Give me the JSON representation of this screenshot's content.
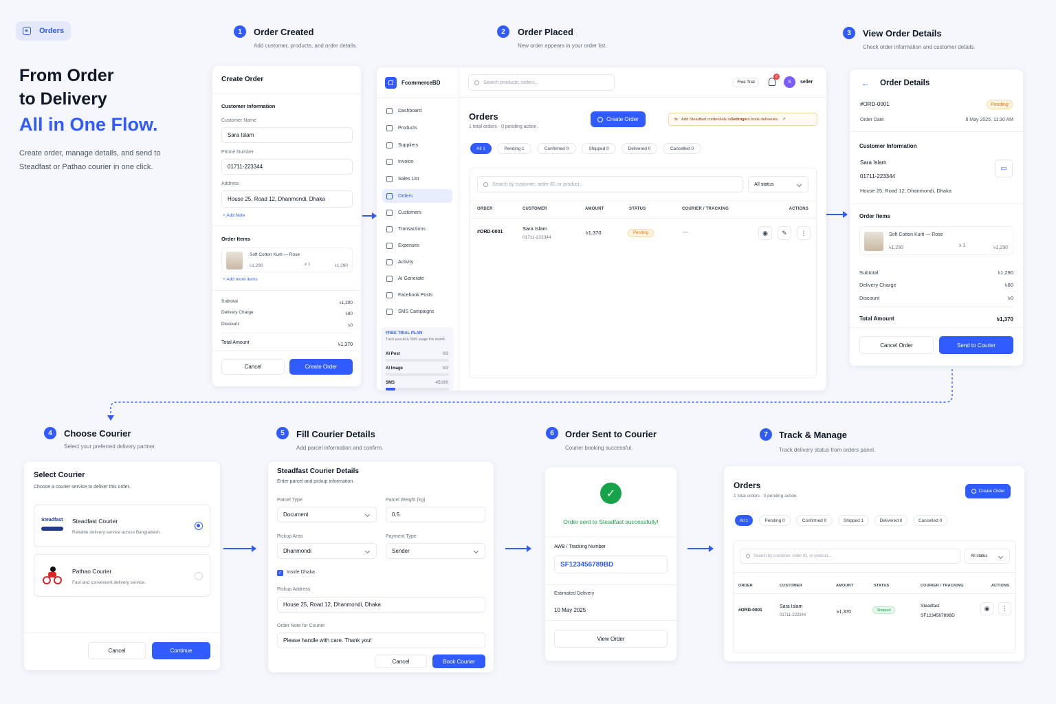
{
  "pill": {
    "label": "Orders"
  },
  "hero": {
    "line1": "From Order",
    "line2": "to Delivery",
    "line3": "All in One Flow.",
    "desc1": "Create order, manage details, and send to",
    "desc2": "Steadfast or Pathao courier in one click."
  },
  "steps": [
    {
      "num": "1",
      "title": "Order Created",
      "sub": "Add customer, products, and order details."
    },
    {
      "num": "2",
      "title": "Order Placed",
      "sub": "New order appears in your order list."
    },
    {
      "num": "3",
      "title": "View Order Details",
      "sub": "Check order information and customer details."
    },
    {
      "num": "4",
      "title": "Choose Courier",
      "sub": "Select your preferred delivery partner."
    },
    {
      "num": "5",
      "title": "Fill Courier Details",
      "sub": "Add parcel information and confirm."
    },
    {
      "num": "6",
      "title": "Order Sent to Courier",
      "sub": "Courier booking successful."
    },
    {
      "num": "7",
      "title": "Track & Manage",
      "sub": "Track delivery status from orders panel."
    }
  ],
  "create": {
    "title": "Create Order",
    "customer_section": "Customer Information",
    "name_label": "Customer Name",
    "name_value": "Sara Islam",
    "phone_label": "Phone Number",
    "phone_value": "01711-223344",
    "address_label": "Address",
    "address_value": "House 25, Road 12, Dhanmondi, Dhaka",
    "add_note": "Add Note",
    "items_section": "Order Items",
    "item_name": "Soft Cotton Kurti — Rose",
    "item_price": "৳1,290",
    "item_qty": "x 1",
    "item_total": "৳1,290",
    "add_more": "Add more items",
    "subtotal_label": "Subtotal",
    "subtotal": "৳1,290",
    "delivery_label": "Delivery Charge",
    "delivery": "৳80",
    "discount_label": "Discount",
    "discount": "৳0",
    "total_label": "Total Amount",
    "total": "৳1,370",
    "cancel": "Cancel",
    "submit": "Create Order"
  },
  "dashboard": {
    "brand": "FcommerceBD",
    "search_placeholder": "Search products, orders...",
    "free_trial": "Free Trial",
    "notif_count": "6",
    "avatar": "S",
    "user": "seller",
    "nav": [
      "Dashboard",
      "Products",
      "Suppliers",
      "Invoice",
      "Sales List",
      "Orders",
      "Customers",
      "Transactions",
      "Expenses",
      "Activity",
      "AI Generate",
      "Facebook Posts",
      "SMS Campaigns"
    ],
    "plan": {
      "title": "FREE TRIAL PLAN",
      "desc": "Track your AI & SMS usage this month.",
      "ai_post": "AI Post",
      "ai_post_v": "0/3",
      "ai_image": "AI Image",
      "ai_image_v": "0/3",
      "sms": "SMS",
      "sms_v": "45/300",
      "sms_fraction": 0.15
    },
    "title": "Orders",
    "summary": "1 total orders · 0 pending action.",
    "create_btn": "Create Order",
    "notice_pre": "Add Steadfast credentials in ",
    "notice_bold": "Settings",
    "notice_post": " to book deliveries.",
    "tabs": [
      "All 1",
      "Pending 1",
      "Confirmed 0",
      "Shipped 0",
      "Delivered 0",
      "Cancelled 0"
    ],
    "table_search": "Search by customer, order ID, or product...",
    "status_filter": "All status",
    "cols": [
      "ORDER",
      "CUSTOMER",
      "AMOUNT",
      "STATUS",
      "COURIER / TRACKING",
      "ACTIONS"
    ],
    "row": {
      "id": "#ORD-0001",
      "name": "Sara Islam",
      "phone": "01711-223344",
      "amount": "৳1,370",
      "status": "Pending",
      "courier": "—"
    }
  },
  "details": {
    "title": "Order Details",
    "id": "#ORD-0001",
    "status": "Pending",
    "date_label": "Order Date",
    "date": "8 May 2025, 11:30 AM",
    "customer_section": "Customer Information",
    "name": "Sara Islam",
    "phone": "01711-223344",
    "address": "House 25, Road 12, Dhanmondi, Dhaka",
    "items_section": "Order Items",
    "item_name": "Soft Cotton Kurti — Rose",
    "item_price": "৳1,290",
    "item_qty": "x 1",
    "item_total": "৳1,290",
    "subtotal_label": "Subtotal",
    "subtotal": "৳1,290",
    "delivery_label": "Delivery Charge",
    "delivery": "৳80",
    "discount_label": "Discount",
    "discount": "৳0",
    "total_label": "Total Amount",
    "total": "৳1,370",
    "cancel": "Cancel Order",
    "send": "Send to Courier"
  },
  "select": {
    "title": "Select Courier",
    "sub": "Choose a courier service to deliver this order.",
    "opt1_logo": "Steadfast",
    "opt1_name": "Steadfast Courier",
    "opt1_desc": "Reliable delivery service across Bangladesh.",
    "opt2_name": "Pathao Courier",
    "opt2_desc": "Fast and convenient delivery service.",
    "cancel": "Cancel",
    "continue": "Continue"
  },
  "courier": {
    "title": "Steadfast Courier Details",
    "sub": "Enter parcel and pickup information.",
    "parcel_type_label": "Parcel Type",
    "parcel_type": "Document",
    "weight_label": "Parcel Weight (kg)",
    "weight": "0.5",
    "pickup_area_label": "Pickup Area",
    "pickup_area": "Dhanmondi",
    "payment_label": "Payment Type",
    "payment": "Sender",
    "inside_dhaka": "Inside Dhaka",
    "pickup_address_label": "Pickup Address",
    "pickup_address": "House 25, Road 12, Dhanmondi, Dhaka",
    "note_label": "Order Note for Courier",
    "note": "Please handle with care. Thank you!",
    "cancel": "Cancel",
    "book": "Book Courier"
  },
  "success": {
    "message": "Order sent to Steadfast successfully!",
    "awb_label": "AWB / Tracking Number",
    "awb": "SF123456789BD",
    "est_label": "Estimated Delivery",
    "est": "10 May 2025",
    "view": "View Order"
  },
  "track": {
    "title": "Orders",
    "summary": "1 total orders · 0 pending action.",
    "create_btn": "Create Order",
    "tabs": [
      "All 1",
      "Pending 0",
      "Confirmed 0",
      "Shipped 1",
      "Delivered 0",
      "Cancelled 0"
    ],
    "table_search": "Search by customer, order ID, or product...",
    "status_filter": "All status",
    "cols": [
      "ORDER",
      "CUSTOMER",
      "AMOUNT",
      "STATUS",
      "COURIER / TRACKING",
      "ACTIONS"
    ],
    "row": {
      "id": "#ORD-0001",
      "name": "Sara Islam",
      "phone": "01711-223344",
      "amount": "৳1,370",
      "status": "Shipped",
      "courier": "Steadfast",
      "tracking": "SF123456789BD"
    }
  },
  "colors": {
    "accent": "#2f5bff",
    "pending": "#f59e0b",
    "shipped": "#16a34a"
  }
}
